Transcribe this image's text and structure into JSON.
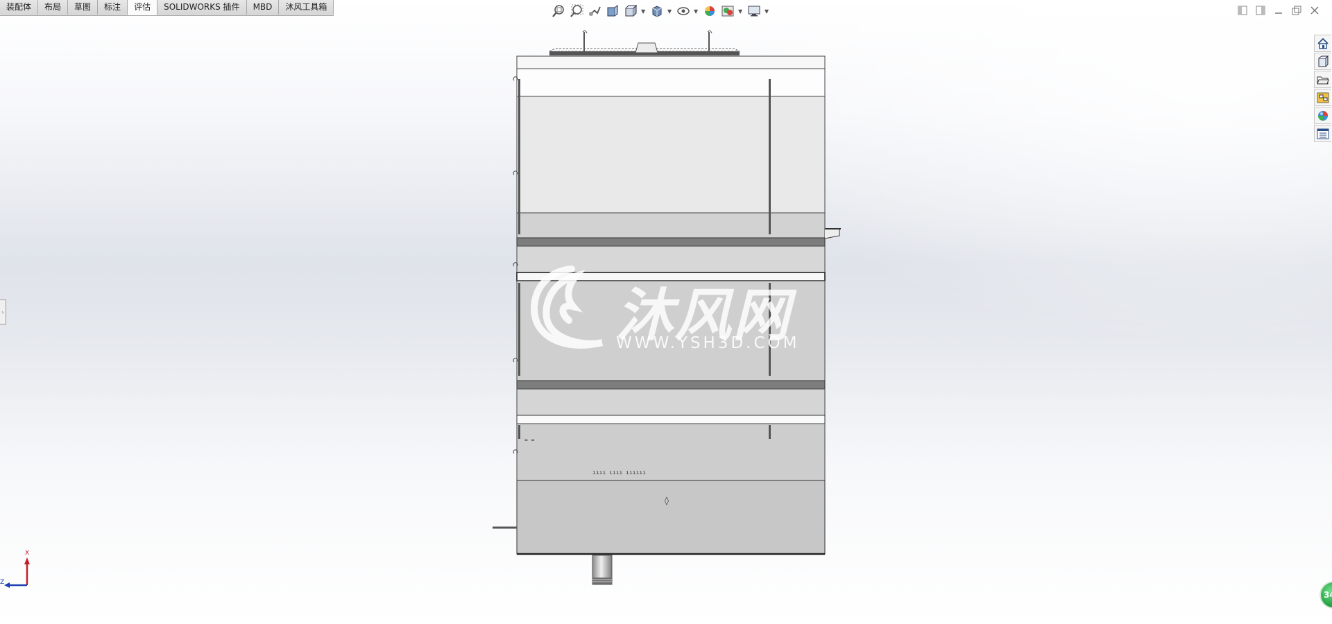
{
  "tabs": [
    {
      "label": "装配体"
    },
    {
      "label": "布局"
    },
    {
      "label": "草图"
    },
    {
      "label": "标注"
    },
    {
      "label": "评估",
      "active": true
    },
    {
      "label": "SOLIDWORKS 插件"
    },
    {
      "label": "MBD"
    },
    {
      "label": "沐风工具箱"
    }
  ],
  "hud_icons": [
    "zoom-to-fit-icon",
    "zoom-to-area-icon",
    "previous-view-icon",
    "section-view-icon",
    "dynamic-annotation-icon",
    "view-orientation-icon",
    "display-style-icon",
    "hide-show-items-icon",
    "edit-appearance-icon",
    "apply-scene-icon",
    "view-settings-icon"
  ],
  "window_controls": [
    "tile-left-icon",
    "tile-right-icon",
    "minimize-icon",
    "restore-icon",
    "close-icon"
  ],
  "task_pane": [
    "home-icon",
    "design-library-icon",
    "file-explorer-icon",
    "view-palette-icon",
    "appearances-icon",
    "custom-properties-icon"
  ],
  "watermark": {
    "logo_text": "沐风网",
    "url": "WWW.YSH3D.COM"
  },
  "triad": {
    "x_label": "X",
    "z_label": "Z"
  },
  "status_ball": {
    "text": "34"
  },
  "colors": {
    "tab_active": "#fbfbfb",
    "tab_bg": "#dcdcdc",
    "model_face": "#c8c8c8",
    "model_face_light": "#e6e6e6",
    "band_dark": "#7a7a7a",
    "triad_x": "#c0202a",
    "triad_z": "#1f3fb0"
  }
}
